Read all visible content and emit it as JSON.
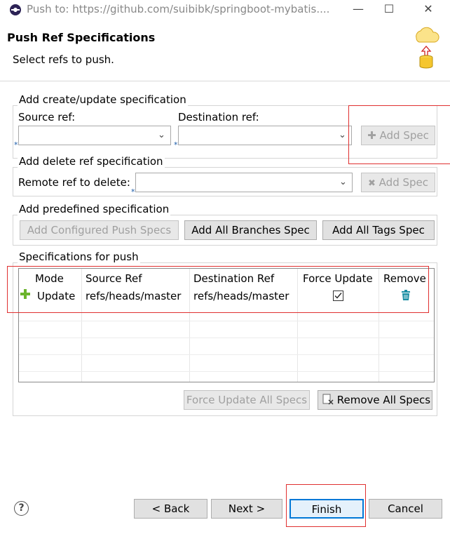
{
  "window": {
    "title": "Push to: https://github.com/suibibk/springboot-mybatis...."
  },
  "header": {
    "title": "Push Ref Specifications",
    "subtitle": "Select refs to push."
  },
  "create_group": {
    "label": "Add create/update specification",
    "source_label": "Source ref:",
    "destination_label": "Destination ref:",
    "source_value": "",
    "destination_value": "",
    "add_spec_label": "Add Spec"
  },
  "delete_group": {
    "label": "Add delete ref specification",
    "remote_label": "Remote ref to delete:",
    "remote_value": "",
    "add_spec_label": "Add Spec"
  },
  "predefined_group": {
    "label": "Add predefined specification",
    "configured_label": "Add Configured Push Specs",
    "all_branches_label": "Add All Branches Spec",
    "all_tags_label": "Add All Tags Spec"
  },
  "specs_group": {
    "label": "Specifications for push",
    "columns": [
      "Mode",
      "Source Ref",
      "Destination Ref",
      "Force Update",
      "Remove"
    ],
    "rows": [
      {
        "mode": "Update",
        "source": "refs/heads/master",
        "destination": "refs/heads/master",
        "force_update": true
      }
    ],
    "force_all_label": "Force Update All Specs",
    "remove_all_label": "Remove All Specs"
  },
  "footer": {
    "help_symbol": "?",
    "back_label": "< Back",
    "next_label": "Next >",
    "finish_label": "Finish",
    "cancel_label": "Cancel"
  },
  "icons": {
    "app": "eclipse-icon",
    "banner": "push-to-cloud-icon",
    "add_row": "plus-icon",
    "remove_row": "trash-icon"
  },
  "colors": {
    "annotation_red": "#e03030",
    "plus_green": "#6bb42c",
    "trash_teal": "#1b8ea3"
  }
}
